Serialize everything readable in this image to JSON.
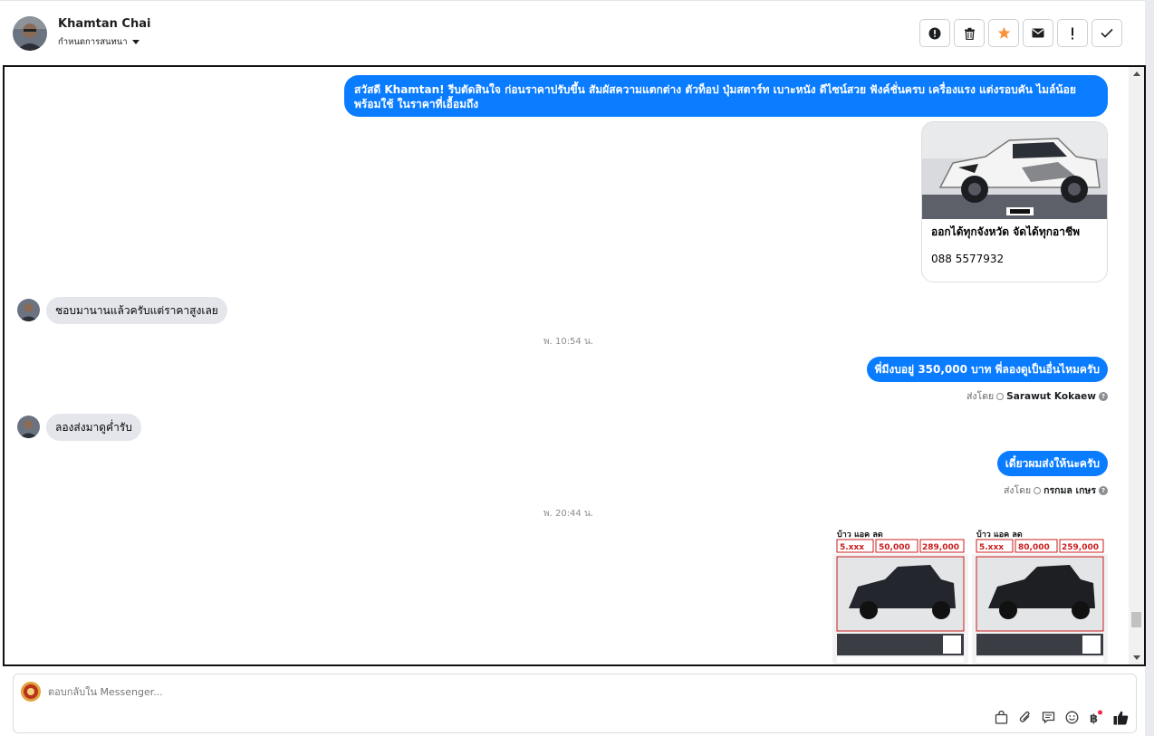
{
  "header": {
    "contact_name": "Khamtan Chai",
    "status_label": "กำหนดการสนทนา"
  },
  "actions": [
    "info-icon",
    "trash-icon",
    "star-icon",
    "mail-icon",
    "alert-icon",
    "check-icon"
  ],
  "messages": {
    "greeting": "สวัสดี Khamtan!  รีบตัดสินใจ ก่อนราคาปรับขึ้น สัมผัสความแตกต่าง ตัวท็อป ปุ่มสตาร์ท เบาะหนัง ดีไซน์สวย ฟังค์ชั่นครบ เครื่องแรง แต่งรอบคัน ไมล์น้อย พร้อมใช้ ในราคาที่เอื้อมถึง",
    "card_title": "ออกได้ทุกจังหวัด จัดได้ทุกอาชีพ",
    "card_phone": "088 5577932",
    "incoming_1": "ชอบมานานแล้วครับแต่ราคาสูงเลย",
    "timestamp_1": "พ. 10:54 น.",
    "outgoing_2": "พี่มีงบอยู่ 350,000 บาท พี่ลองดูเป็นอื่นไหมครับ",
    "sent_by_label": "ส่งโดย",
    "sender_1": "Sarawut Kokaew",
    "incoming_2": "ลองส่งมาดูค่ำรับ",
    "outgoing_3": "เดี๋ยวผมส่งให้นะครับ",
    "sender_2": "กรกมล เกษร",
    "timestamp_2": "พ. 20:44 น."
  },
  "promos": [
    {
      "brand": "บ้าว แอค ลด",
      "price_a": "5.xxx",
      "price_b": "50,000",
      "price_c": "289,000"
    },
    {
      "brand": "บ้าว แอค ลด",
      "price_a": "5.xxx",
      "price_b": "80,000",
      "price_c": "259,000"
    }
  ],
  "composer": {
    "placeholder": "ตอบกลับใน Messenger..."
  },
  "colors": {
    "accent": "#0a7cff",
    "star": "#f7923a",
    "incoming_bg": "#e4e6eb"
  }
}
